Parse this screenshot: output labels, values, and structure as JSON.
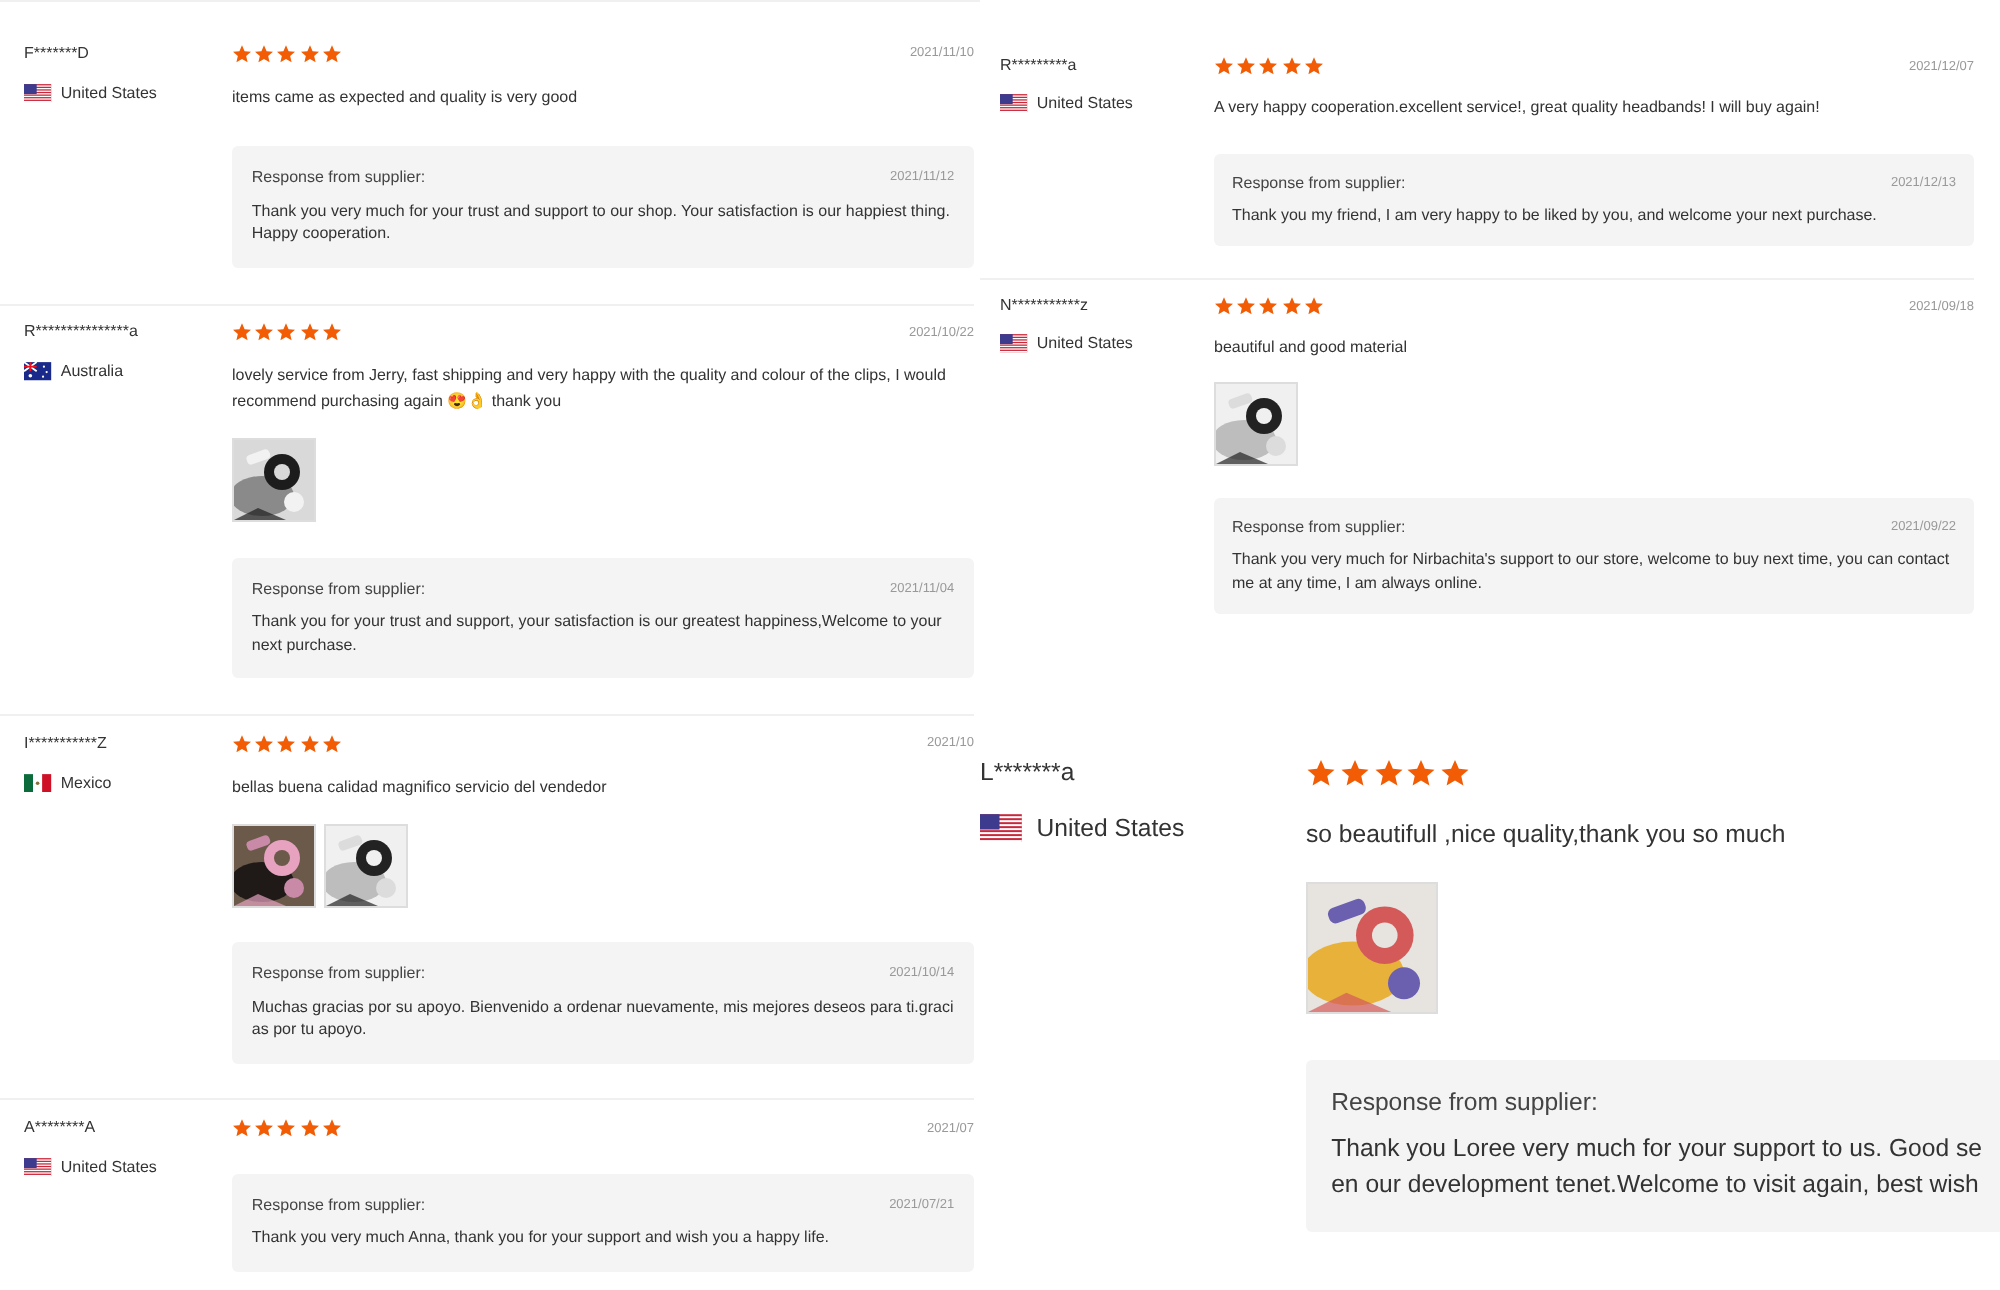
{
  "panels": [
    {
      "reviews": [
        {
          "name": "F*******D",
          "flag": {
            "kind": "us"
          },
          "country": "United States",
          "stars": 5,
          "date": "2021/11/10",
          "comment": "items came as expected and quality is very good",
          "response": {
            "label": "Response from supplier:",
            "date": "2021/11/12",
            "text": "Thank you very much for your trust and support to our shop. Your satisfaction is our happiest thing. Happy cooperation."
          }
        },
        {
          "name": "R***************a",
          "flag": {
            "kind": "au"
          },
          "country": "Australia",
          "stars": 5,
          "date": "2021/10/22",
          "comment": "lovely service from Jerry, fast shipping and very happy with the quality and colour of the clips, I would recommend purchasing again 😍👌 thank you",
          "photos": [
            {
              "kind": "picture"
            }
          ],
          "response": {
            "label": "Response from supplier:",
            "date": "2021/11/04",
            "text": "Thank you for your trust and support, your satisfaction is our greatest happiness,Welcome to your next purchase."
          }
        },
        {
          "name": "I***********Z",
          "flag": {
            "kind": "mx"
          },
          "country": "Mexico",
          "stars": 5,
          "date": "2021/10",
          "comment": "bellas buena calidad magnifico servicio del vendedor",
          "photos": [
            {
              "kind": "picture"
            },
            {
              "kind": "picture"
            }
          ],
          "response": {
            "label": "Response from supplier:",
            "date": "2021/10/14",
            "text": "Muchas gracias por su apoyo. Bienvenido a ordenar nuevamente, mis mejores deseos para ti.gracias por tu apoyo."
          }
        },
        {
          "name": "A********A",
          "flag": {
            "kind": "us"
          },
          "country": "United States",
          "stars": 5,
          "date": "2021/07",
          "response": {
            "label": "Response from supplier:",
            "date": "2021/07/21",
            "text": "Thank you very much Anna, thank you for your support and wish you a happy life."
          }
        }
      ]
    },
    {
      "reviews": [
        {
          "name": "R*********a",
          "flag": {
            "kind": "us"
          },
          "country": "United States",
          "stars": 5,
          "date": "2021/12/07",
          "comment": "A very happy cooperation.excellent service!, great quality headbands! I will buy again!",
          "response": {
            "label": "Response from supplier:",
            "date": "2021/12/13",
            "text": "Thank you my friend, I am very happy to be liked by you, and welcome your next purchase."
          }
        },
        {
          "name": "N***********z",
          "flag": {
            "kind": "us"
          },
          "country": "United States",
          "stars": 5,
          "date": "2021/09/18",
          "comment": "beautiful and good material",
          "photos": [
            {
              "kind": "picture"
            }
          ],
          "response": {
            "label": "Response from supplier:",
            "date": "2021/09/22",
            "text": "Thank you very much for Nirbachita's support to our store, welcome to buy next time, you can contact me at any time, I am always online."
          }
        }
      ]
    },
    {
      "reviews": [
        {
          "name": "L*******a",
          "flag": {
            "kind": "us"
          },
          "country": "United States",
          "stars": 5,
          "comment": "so beautifull ,nice quality,thank you so much",
          "photos": [
            {
              "kind": "picture"
            }
          ],
          "response": {
            "label": "Response from supplier:",
            "lines": [
              "Thank you Loree very much for your support to us. Good se",
              "en our development tenet.Welcome to visit again, best wish"
            ]
          }
        }
      ]
    }
  ]
}
